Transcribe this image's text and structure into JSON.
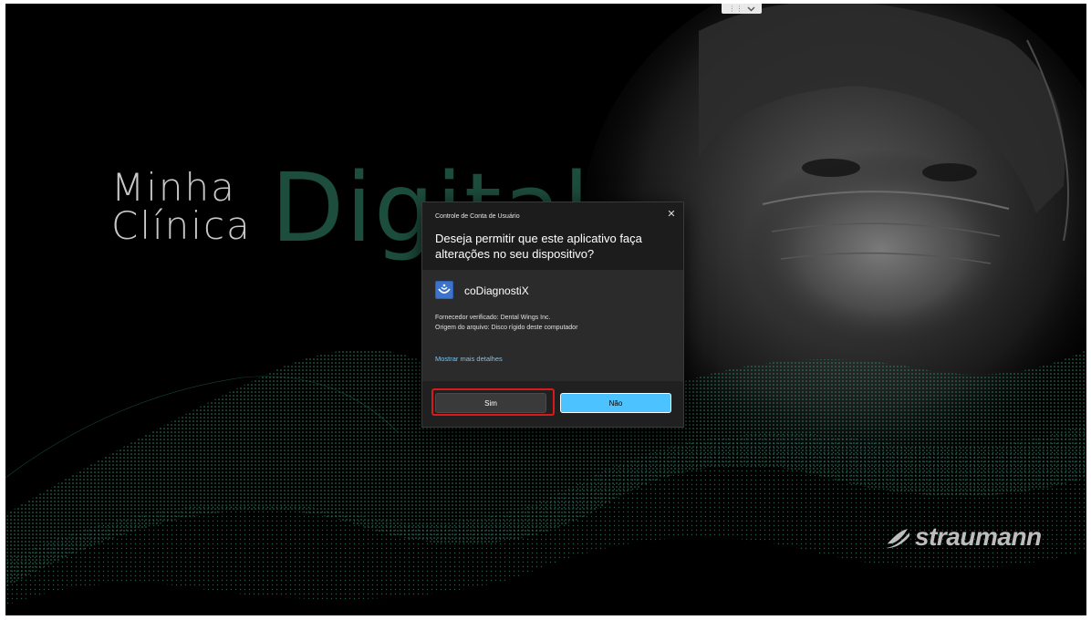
{
  "screen": {
    "toolbar_dots": "⋮⋮",
    "wallpaper": {
      "title_line1": "Minha",
      "title_line2": "Clínica",
      "title_accent": "Digital",
      "accent_color": "#1d4d3d",
      "brand_name": "straumann",
      "brand_icon": "straumann-logo-icon"
    }
  },
  "uac_dialog": {
    "caption": "Controle de Conta de Usuário",
    "close_glyph": "✕",
    "question": "Deseja permitir que este aplicativo faça alterações no seu dispositivo?",
    "app_name": "coDiagnostiX",
    "app_icon": "codiagnostix-app-icon",
    "publisher": "Fornecedor verificado: Dental Wings Inc.",
    "origin": "Origem do arquivo: Disco rígido deste computador",
    "details_link": "Mostrar mais detalhes",
    "yes_label": "Sim",
    "no_label": "Não",
    "highlight_color": "#d81a1a",
    "primary_color": "#4cc2ff"
  }
}
